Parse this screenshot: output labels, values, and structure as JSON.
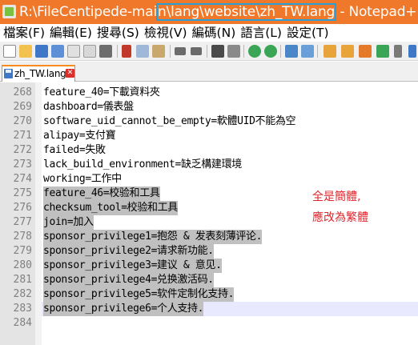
{
  "window": {
    "title_prefix": "R:\\FileCentipede-mai",
    "title_highlight": "n\\lang\\website\\zh_TW.lang",
    "title_suffix": " - Notepad++"
  },
  "menu": [
    "檔案(F)",
    "編輯(E)",
    "搜尋(S)",
    "檢視(V)",
    "編碼(N)",
    "語言(L)",
    "設定(T)"
  ],
  "toolbar": {
    "icons": [
      "new-file",
      "open-file",
      "save",
      "save-all",
      "close",
      "close-all",
      "print",
      "cut",
      "copy",
      "paste",
      "undo",
      "redo",
      "find",
      "replace",
      "zoom-in",
      "zoom-out",
      "sync-vertical",
      "sync-horizontal",
      "word-wrap",
      "show-all-chars",
      "indent-guide"
    ]
  },
  "tab": {
    "label": "zh_TW.lang",
    "close": "✕"
  },
  "lines": [
    {
      "n": "268",
      "text": "feature_40=下載資料夾",
      "selected": false
    },
    {
      "n": "269",
      "text": "dashboard=儀表盤",
      "selected": false
    },
    {
      "n": "270",
      "text": "software_uid_cannot_be_empty=軟體UID不能為空",
      "selected": false
    },
    {
      "n": "271",
      "text": "alipay=支付寶",
      "selected": false
    },
    {
      "n": "272",
      "text": "failed=失敗",
      "selected": false
    },
    {
      "n": "273",
      "text": "lack_build_environment=缺乏構建環境",
      "selected": false
    },
    {
      "n": "274",
      "text": "working=工作中",
      "selected": false
    },
    {
      "n": "275",
      "text": "feature_46=校验和工具",
      "selected": true
    },
    {
      "n": "276",
      "text": "checksum_tool=校验和工具",
      "selected": true
    },
    {
      "n": "277",
      "text": "join=加入",
      "selected": true
    },
    {
      "n": "278",
      "text": "sponsor_privilege1=抱怨 & 发表刻薄评论.",
      "selected": true
    },
    {
      "n": "279",
      "text": "sponsor_privilege2=请求新功能.",
      "selected": true
    },
    {
      "n": "280",
      "text": "sponsor_privilege3=建议 & 意见.",
      "selected": true
    },
    {
      "n": "281",
      "text": "sponsor_privilege4=兑换激活码.",
      "selected": true
    },
    {
      "n": "282",
      "text": "sponsor_privilege5=软件定制化支持.",
      "selected": true
    },
    {
      "n": "283",
      "text": "sponsor_privilege6=个人支持.",
      "selected": true
    },
    {
      "n": "284",
      "text": "",
      "selected": false
    }
  ],
  "annotation": {
    "line1": "全是簡體,",
    "line2": "應改為繁體"
  },
  "colors": {
    "titlebar": "#f0782a",
    "title_highlight_border": "#2a9fd6",
    "selection": "#c0c0c0",
    "current_line": "#e8e8ff",
    "annotation": "#e0252b"
  }
}
